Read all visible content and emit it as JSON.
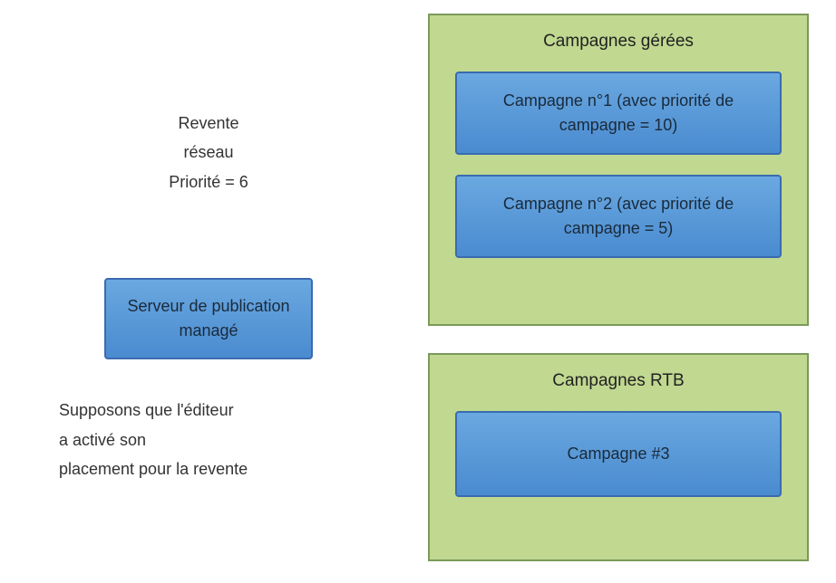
{
  "left": {
    "line1": "Revente",
    "line2": "réseau",
    "line3": "Priorité = 6",
    "publisher_box": "Serveur de publication managé",
    "footnote_line1": "Supposons que l'éditeur",
    "footnote_line2": "a activé son",
    "footnote_line3": "placement pour la revente"
  },
  "panel_managed": {
    "title": "Campagnes gérées",
    "campaign1": "Campagne n°1 (avec priorité de campagne = 10)",
    "campaign2": "Campagne n°2 (avec priorité de campagne = 5)"
  },
  "panel_rtb": {
    "title": "Campagnes RTB",
    "campaign3": "Campagne #3"
  }
}
